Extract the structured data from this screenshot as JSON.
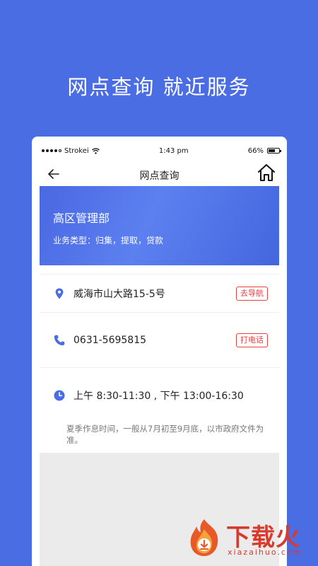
{
  "headline": "网点查询  就近服务",
  "status_bar": {
    "carrier": "Strokei",
    "time": "1:43 pm",
    "battery": "66%",
    "battery_level": 0.66
  },
  "nav": {
    "title": "网点查询",
    "back_icon": "back-arrow-icon",
    "home_icon": "home-icon"
  },
  "branch": {
    "name": "高区管理部",
    "business": "业务类型：归集，提取，贷款"
  },
  "address": {
    "text": "威海市山大路15-5号",
    "action": "去导航",
    "icon": "location-pin-icon"
  },
  "phone": {
    "text": "0631-5695815",
    "action": "打电话",
    "icon": "phone-icon"
  },
  "hours": {
    "text": "上午 8:30-11:30 , 下午 13:00-16:30",
    "note": "夏季作息时间，一般从7月初至9月底，以市政府文件为准。",
    "icon": "clock-icon"
  },
  "watermark": {
    "text": "下载火",
    "sub": "xiazaihuo.com"
  },
  "colors": {
    "background": "#4a6de3",
    "accent": "#4a6de3",
    "action_red": "#e64242",
    "watermark": "#d93a2b"
  }
}
